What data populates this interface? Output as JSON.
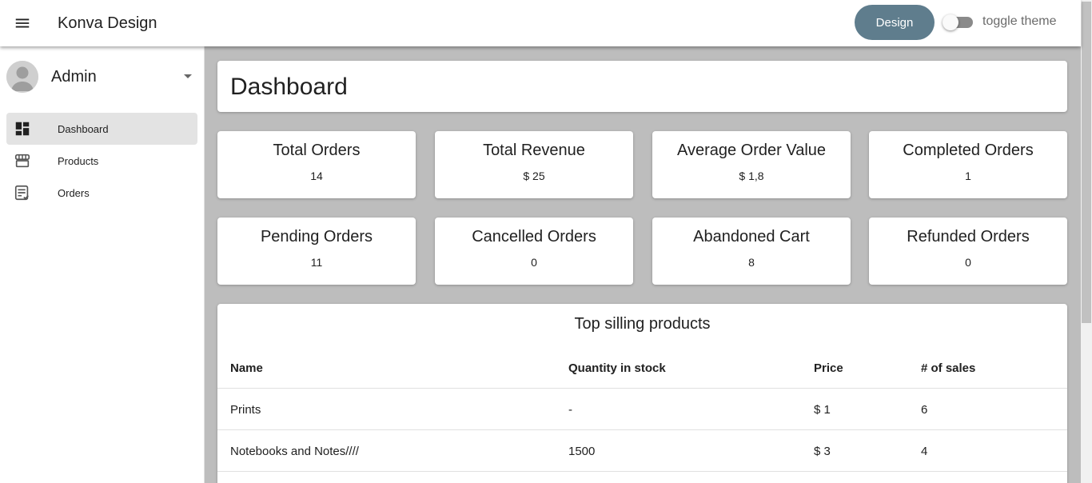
{
  "app": {
    "title": "Konva Design"
  },
  "topbar": {
    "design_label": "Design",
    "toggle_label": "toggle theme"
  },
  "sidebar": {
    "user_name": "Admin",
    "items": [
      {
        "label": "Dashboard",
        "icon": "dashboard-icon",
        "active": true
      },
      {
        "label": "Products",
        "icon": "storefront-icon",
        "active": false
      },
      {
        "label": "Orders",
        "icon": "orders-list-icon",
        "active": false
      }
    ]
  },
  "main": {
    "page_title": "Dashboard",
    "stats": [
      {
        "title": "Total Orders",
        "value": "14"
      },
      {
        "title": "Total Revenue",
        "value": "$ 25"
      },
      {
        "title": "Average Order Value",
        "value": "$ 1,8"
      },
      {
        "title": "Completed Orders",
        "value": "1"
      },
      {
        "title": "Pending Orders",
        "value": "11"
      },
      {
        "title": "Cancelled Orders",
        "value": "0"
      },
      {
        "title": "Abandoned Cart",
        "value": "8"
      },
      {
        "title": "Refunded Orders",
        "value": "0"
      }
    ],
    "table": {
      "title": "Top silling products",
      "headers": [
        "Name",
        "Quantity in stock",
        "Price",
        "# of sales"
      ],
      "rows": [
        [
          "Prints",
          "-",
          "$ 1",
          "6"
        ],
        [
          "Notebooks and Notes////",
          "1500",
          "$ 3",
          "4"
        ]
      ]
    }
  },
  "colors": {
    "accent": "#5f7d8d",
    "content_bg": "#bdbdbd",
    "active_nav": "#e3e3e3"
  }
}
